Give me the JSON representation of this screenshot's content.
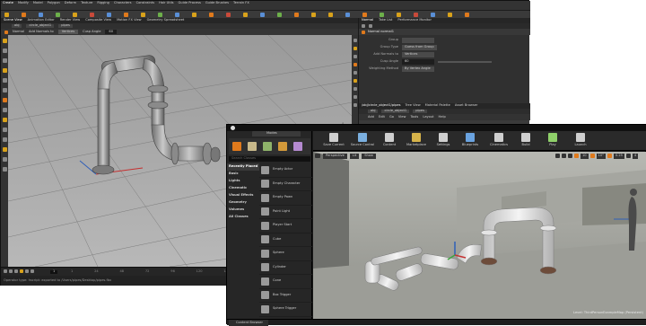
{
  "houdini": {
    "shelf_tabs": [
      "Create",
      "Modify",
      "Model",
      "Polygon",
      "Deform",
      "Texture",
      "Rigging",
      "Characters",
      "Constraints",
      "Hair Utils",
      "Guide Process",
      "Guide Brushes",
      "Terrain FX"
    ],
    "menu_tabs": [
      "Scene View",
      "Animation Editor",
      "Render View",
      "Composite View",
      "Motion FX View",
      "Geometry Spreadsheet"
    ],
    "path_crumbs": [
      "obj",
      "circle_object1",
      "pipes"
    ],
    "viewport_toolbar": {
      "node": "Normal",
      "label": "Add Normals to",
      "mode": "Vertices",
      "cusp_label": "Cusp Angle",
      "cusp_value": "60"
    },
    "param_tabs": [
      "Normal",
      "Take List",
      "Performance Monitor"
    ],
    "param_title": "Normal normal1",
    "params": [
      {
        "label": "Group",
        "value": ""
      },
      {
        "label": "Group Type",
        "value": "Guess from Group"
      },
      {
        "label": "Add Normals to",
        "value": "Vertices"
      },
      {
        "label": "Cusp Angle",
        "value": "60"
      },
      {
        "label": "Weighting Method",
        "value": "By Vertex Angle"
      }
    ],
    "network_tabs": [
      "/obj/circle_object1/pipes",
      "Tree View",
      "Material Palette",
      "Asset Browser"
    ],
    "network_menu": [
      "Add",
      "Edit",
      "Go",
      "View",
      "Tools",
      "Layout",
      "Help"
    ],
    "frames": {
      "start": "1",
      "ticks": [
        "1",
        "24",
        "48",
        "72",
        "96",
        "120",
        "144",
        "168",
        "192",
        "216",
        "240"
      ]
    },
    "status": "Operator type: hscript: exported to /Users/pipes/Desktop/pipes.fbx"
  },
  "unreal": {
    "modes_tab": "Modes",
    "search_placeholder": "Search Classes",
    "categories": [
      "Recently Placed",
      "Basic",
      "Lights",
      "Cinematic",
      "Visual Effects",
      "Geometry",
      "Volumes",
      "All Classes"
    ],
    "actors": [
      "Empty Actor",
      "Empty Character",
      "Empty Pawn",
      "Point Light",
      "Player Start",
      "Cube",
      "Sphere",
      "Cylinder",
      "Cone",
      "Box Trigger",
      "Sphere Trigger"
    ],
    "toolbar": [
      "Save Current",
      "Source Control",
      "Content",
      "Marketplace",
      "Settings",
      "Blueprints",
      "Cinematics",
      "Build",
      "Play",
      "Launch"
    ],
    "viewport": {
      "perspective": "Perspective",
      "lit": "Lit",
      "show": "Show",
      "grid_value": "10",
      "angle_value": "10°",
      "scale_value": "0.25",
      "cam_speed": "4",
      "level_text": "Level: ThirdPersonExampleMap (Persistent)"
    },
    "bottom_tab": "Content Browser"
  },
  "colors": {
    "accent_orange": "#e07a1c",
    "houdini_bg": "#2b2b2b",
    "ue_bg": "#1a1a1a"
  }
}
